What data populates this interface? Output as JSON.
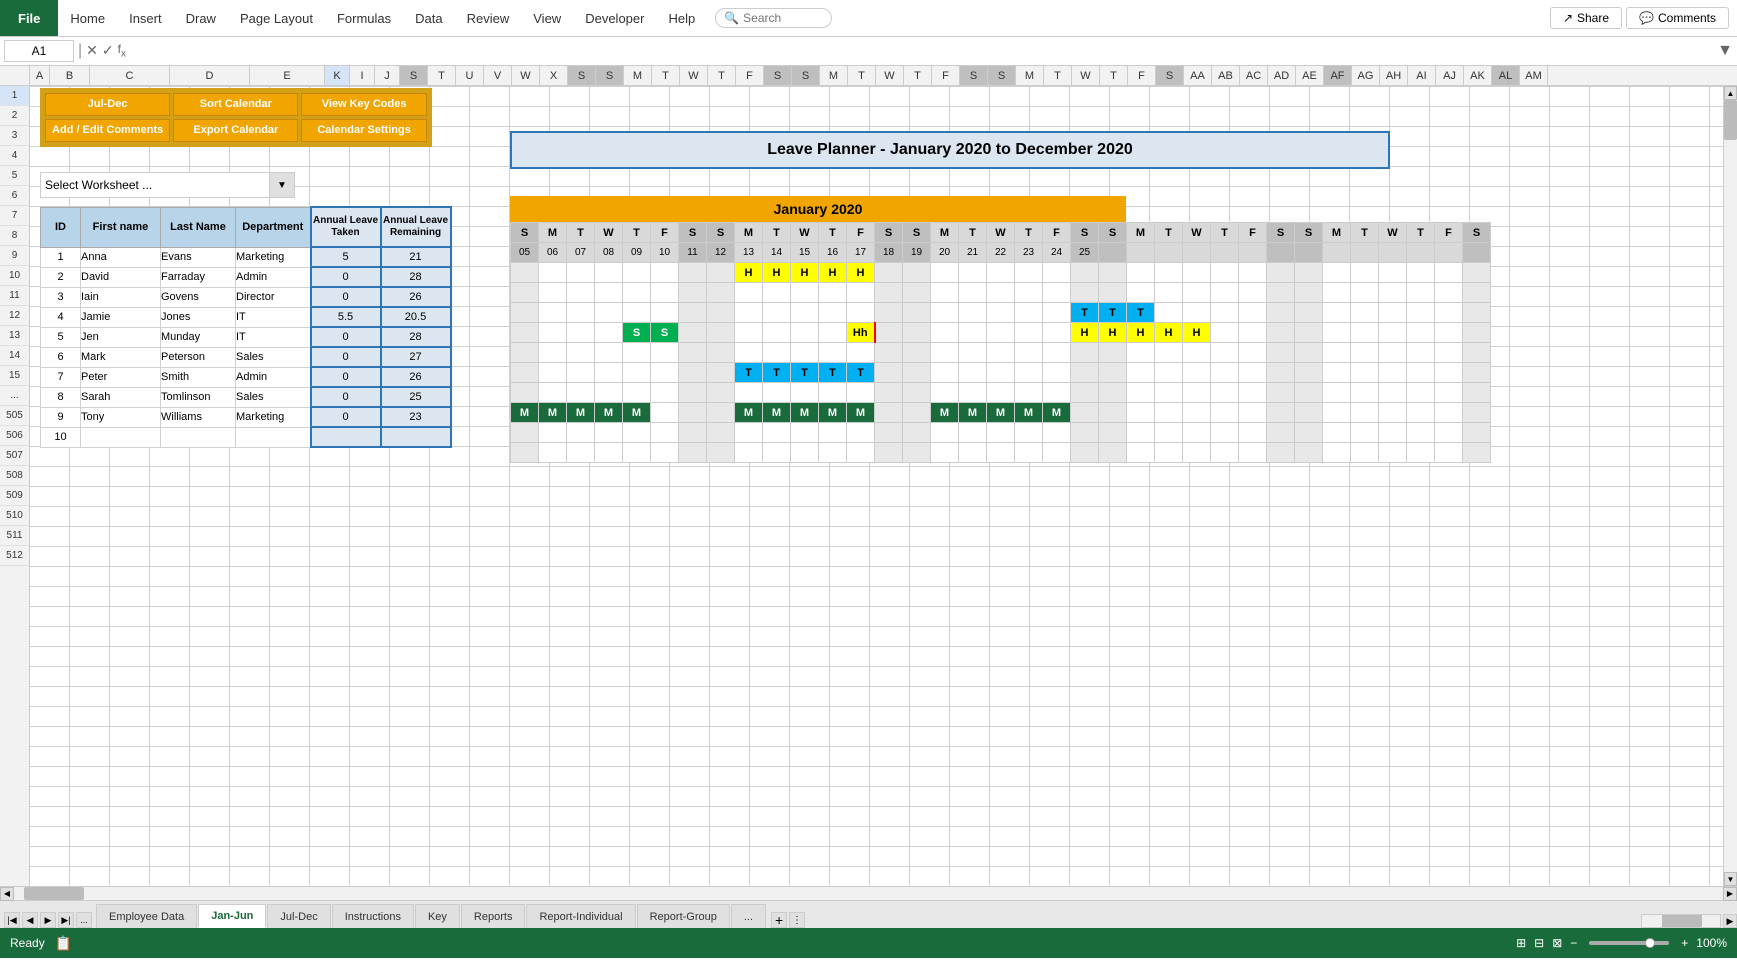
{
  "app": {
    "title": "Leave Planner - January 2020 to December 2020",
    "cell_ref": "A1",
    "formula": ""
  },
  "menu": {
    "file": "File",
    "items": [
      "Home",
      "Insert",
      "Draw",
      "Page Layout",
      "Formulas",
      "Data",
      "Review",
      "View",
      "Developer",
      "Help"
    ],
    "search_placeholder": "Search",
    "share_label": "Share",
    "comments_label": "Comments"
  },
  "toolbar": {
    "buttons": [
      {
        "id": "jul-dec",
        "label": "Jul-Dec"
      },
      {
        "id": "sort-calendar",
        "label": "Sort Calendar"
      },
      {
        "id": "view-key-codes",
        "label": "View Key Codes"
      },
      {
        "id": "add-edit-comments",
        "label": "Add / Edit Comments"
      },
      {
        "id": "export-calendar",
        "label": "Export Calendar"
      },
      {
        "id": "calendar-settings",
        "label": "Calendar Settings"
      }
    ],
    "dropdown_label": "Select Worksheet ...",
    "dropdown_options": [
      "Select Worksheet ...",
      "Employee Data",
      "Jan-Jun",
      "Jul-Dec",
      "Instructions",
      "Key",
      "Reports"
    ]
  },
  "columns": {
    "headers": [
      "A",
      "B",
      "C",
      "D",
      "E",
      "K",
      "I",
      "J",
      "S",
      "T",
      "U",
      "V",
      "W",
      "X",
      "S",
      "S",
      "M",
      "T",
      "W",
      "T",
      "F",
      "S",
      "S",
      "M",
      "T",
      "W",
      "T",
      "F",
      "S",
      "S",
      "M",
      "T",
      "W",
      "T",
      "F",
      "S"
    ]
  },
  "data_table": {
    "headers": [
      "ID",
      "First name",
      "Last Name",
      "Department",
      "Annual Leave Taken",
      "Annual Leave Remaining"
    ],
    "rows": [
      {
        "id": 1,
        "first": "Anna",
        "last": "Evans",
        "dept": "Marketing",
        "taken": 5,
        "remaining": 21
      },
      {
        "id": 2,
        "first": "David",
        "last": "Farraday",
        "dept": "Admin",
        "taken": 0,
        "remaining": 28
      },
      {
        "id": 3,
        "first": "Iain",
        "last": "Govens",
        "dept": "Director",
        "taken": 0,
        "remaining": 26
      },
      {
        "id": 4,
        "first": "Jamie",
        "last": "Jones",
        "dept": "IT",
        "taken": 5.5,
        "remaining": 20.5
      },
      {
        "id": 5,
        "first": "Jen",
        "last": "Munday",
        "dept": "IT",
        "taken": 0,
        "remaining": 28
      },
      {
        "id": 6,
        "first": "Mark",
        "last": "Peterson",
        "dept": "Sales",
        "taken": 0,
        "remaining": 27
      },
      {
        "id": 7,
        "first": "Peter",
        "last": "Smith",
        "dept": "Admin",
        "taken": 0,
        "remaining": 26
      },
      {
        "id": 8,
        "first": "Sarah",
        "last": "Tomlinson",
        "dept": "Sales",
        "taken": 0,
        "remaining": 25
      },
      {
        "id": 9,
        "first": "Tony",
        "last": "Williams",
        "dept": "Marketing",
        "taken": 0,
        "remaining": 23
      },
      {
        "id": 10,
        "first": "",
        "last": "",
        "dept": "",
        "taken": "",
        "remaining": ""
      }
    ]
  },
  "calendar": {
    "title": "January 2020",
    "week_labels": [
      "S",
      "M",
      "T",
      "W",
      "T",
      "F",
      "S",
      "S",
      "M",
      "T",
      "W",
      "T",
      "F",
      "S",
      "S",
      "M",
      "T",
      "W",
      "T",
      "F",
      "S"
    ],
    "date_rows": [
      [
        "05",
        "06",
        "07",
        "08",
        "09",
        "10",
        "11",
        "12",
        "13",
        "14",
        "15",
        "16",
        "17",
        "18",
        "19",
        "20",
        "21",
        "22",
        "23",
        "24",
        "25"
      ]
    ],
    "row_data": [
      [
        null,
        null,
        null,
        null,
        null,
        null,
        null,
        null,
        "H",
        "H",
        "H",
        "H",
        "H",
        null,
        null,
        null,
        null,
        null,
        null,
        null,
        null
      ],
      [
        null,
        null,
        null,
        null,
        null,
        null,
        null,
        null,
        null,
        null,
        null,
        null,
        null,
        null,
        null,
        null,
        null,
        null,
        null,
        null,
        null
      ],
      [
        null,
        null,
        null,
        null,
        null,
        null,
        null,
        null,
        null,
        null,
        null,
        null,
        null,
        null,
        null,
        null,
        null,
        null,
        null,
        null,
        null
      ],
      [
        null,
        null,
        null,
        null,
        "S",
        "S",
        null,
        null,
        null,
        null,
        null,
        null,
        null,
        null,
        null,
        null,
        null,
        null,
        null,
        null,
        null
      ],
      [
        null,
        null,
        null,
        null,
        null,
        null,
        null,
        null,
        null,
        null,
        null,
        null,
        null,
        null,
        null,
        null,
        null,
        null,
        null,
        null,
        null
      ],
      [
        null,
        null,
        null,
        null,
        null,
        null,
        null,
        null,
        "T",
        "T",
        "T",
        "T",
        "T",
        null,
        null,
        null,
        null,
        null,
        null,
        null,
        null
      ],
      [
        "M",
        "M",
        "M",
        "M",
        "M",
        null,
        null,
        null,
        "M",
        "M",
        "M",
        "M",
        "M",
        null,
        null,
        "M",
        "M",
        "M",
        "M",
        "M",
        null
      ],
      [
        null,
        null,
        null,
        null,
        null,
        null,
        null,
        null,
        null,
        null,
        null,
        null,
        null,
        null,
        null,
        null,
        null,
        null,
        null,
        null,
        null
      ],
      [
        null,
        null,
        null,
        null,
        null,
        null,
        null,
        null,
        null,
        null,
        null,
        null,
        null,
        null,
        null,
        null,
        null,
        null,
        null,
        null,
        null
      ]
    ]
  },
  "sheet_tabs": {
    "tabs": [
      "Employee Data",
      "Jan-Jun",
      "Jul-Dec",
      "Instructions",
      "Key",
      "Reports",
      "Report-Individual",
      "Report-Group"
    ],
    "active": "Jan-Jun",
    "more_indicator": "..."
  },
  "status_bar": {
    "ready": "Ready",
    "zoom": "100%"
  },
  "colors": {
    "H_cell": "#ffff00",
    "S_cell": "#00b050",
    "T_cell": "#00b0f0",
    "M_cell": "#1a6b3c",
    "weekend_col": "#bfbfbf",
    "header_bg": "#b8d4e8",
    "leave_border": "#2e75b6",
    "orange_header": "#f0a500",
    "green_tab": "#1a6b3c",
    "title_border": "#2e75b6",
    "title_bg": "#dce6f1"
  }
}
